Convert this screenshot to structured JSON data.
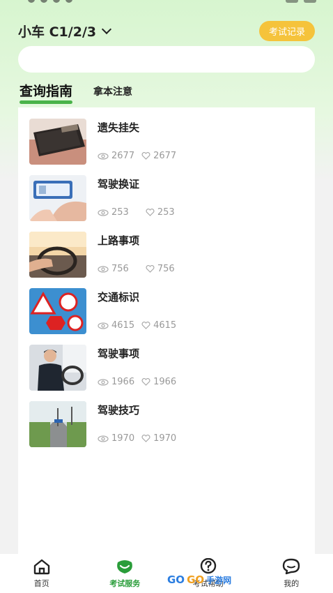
{
  "header": {
    "vehicle_label": "小车 C1/2/3",
    "record_button": "考试记录"
  },
  "search": {
    "placeholder": "",
    "value": ""
  },
  "tabs": [
    {
      "label": "查询指南",
      "active": true
    },
    {
      "label": "拿本注意",
      "active": false
    }
  ],
  "list": [
    {
      "title": "遗失挂失",
      "views": "2677",
      "likes": "2677",
      "thumb": "wallet-photo"
    },
    {
      "title": "驾驶换证",
      "views": "253",
      "likes": "253",
      "thumb": "phone-card-photo"
    },
    {
      "title": "上路事项",
      "views": "756",
      "likes": "756",
      "thumb": "steering-wheel-photo"
    },
    {
      "title": "交通标识",
      "views": "4615",
      "likes": "4615",
      "thumb": "traffic-signs-photo"
    },
    {
      "title": "驾驶事项",
      "views": "1966",
      "likes": "1966",
      "thumb": "driver-photo"
    },
    {
      "title": "驾驶技巧",
      "views": "1970",
      "likes": "1970",
      "thumb": "road-photo"
    }
  ],
  "tabbar": [
    {
      "label": "首页",
      "icon": "home-icon",
      "active": false
    },
    {
      "label": "考试服务",
      "icon": "smile-icon",
      "active": true
    },
    {
      "label": "考试帮助",
      "icon": "help-icon",
      "active": false
    },
    {
      "label": "我的",
      "icon": "chat-face-icon",
      "active": false
    }
  ],
  "watermark": {
    "logo_go1": "GO",
    "logo_go2": "GO",
    "logo_text": "手游网"
  },
  "colors": {
    "accent": "#4ab34a",
    "button": "#f5c33b",
    "active_tab": "#2a9d3a"
  }
}
